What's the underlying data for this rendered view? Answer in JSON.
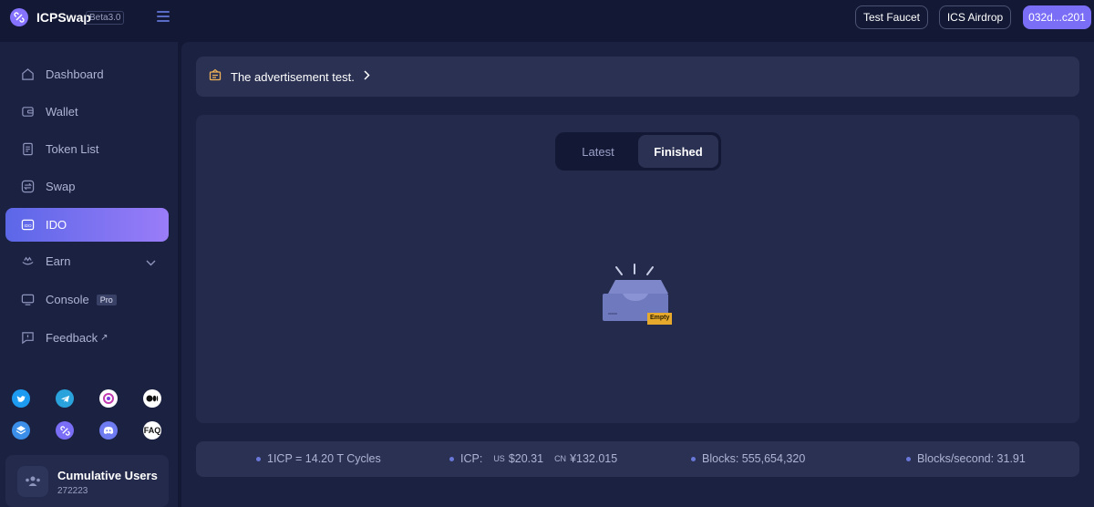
{
  "app": {
    "name": "ICPSwap",
    "badge": "Beta3.0"
  },
  "header": {
    "buttons": {
      "test_faucet": "Test Faucet",
      "ics_airdrop": "ICS Airdrop",
      "account": "032d...c201"
    }
  },
  "sidebar": {
    "items": [
      {
        "label": "Dashboard",
        "icon": "home-icon"
      },
      {
        "label": "Wallet",
        "icon": "wallet-icon"
      },
      {
        "label": "Token List",
        "icon": "document-icon"
      },
      {
        "label": "Swap",
        "icon": "swap-icon"
      },
      {
        "label": "IDO",
        "icon": "ido-icon",
        "active": true
      },
      {
        "label": "Earn",
        "icon": "earn-icon",
        "expandable": true
      },
      {
        "label": "Console",
        "icon": "monitor-icon",
        "badge": "Pro"
      },
      {
        "label": "Feedback",
        "icon": "feedback-icon",
        "external": true
      }
    ],
    "social": {
      "twitter": "twitter-icon",
      "telegram": "telegram-icon",
      "dfinity": "dfinity-icon",
      "medium": "medium-icon",
      "stack": "stack-icon",
      "icpswap": "icpswap-icon",
      "discord": "discord-icon",
      "faq": "FAQ"
    },
    "cumulative": {
      "title": "Cumulative Users",
      "value": "272223"
    }
  },
  "main": {
    "advert": "The advertisement test.",
    "tabs": [
      {
        "label": "Latest",
        "active": false
      },
      {
        "label": "Finished",
        "active": true
      }
    ],
    "empty_label": "Empty"
  },
  "stats": {
    "cycles": "1ICP = 14.20 T Cycles",
    "icp_label": "ICP:",
    "us_label": "US",
    "us_value": "$20.31",
    "cn_label": "CN",
    "cn_value": "¥132.015",
    "blocks": "Blocks: 555,654,320",
    "blocks_per_second": "Blocks/second: 31.91"
  },
  "colors": {
    "background": "#131834",
    "panel": "#1b2140",
    "accent": "#7b6ef6",
    "active_gradient_start": "#5b67e8",
    "active_gradient_end": "#9a7cf8"
  }
}
